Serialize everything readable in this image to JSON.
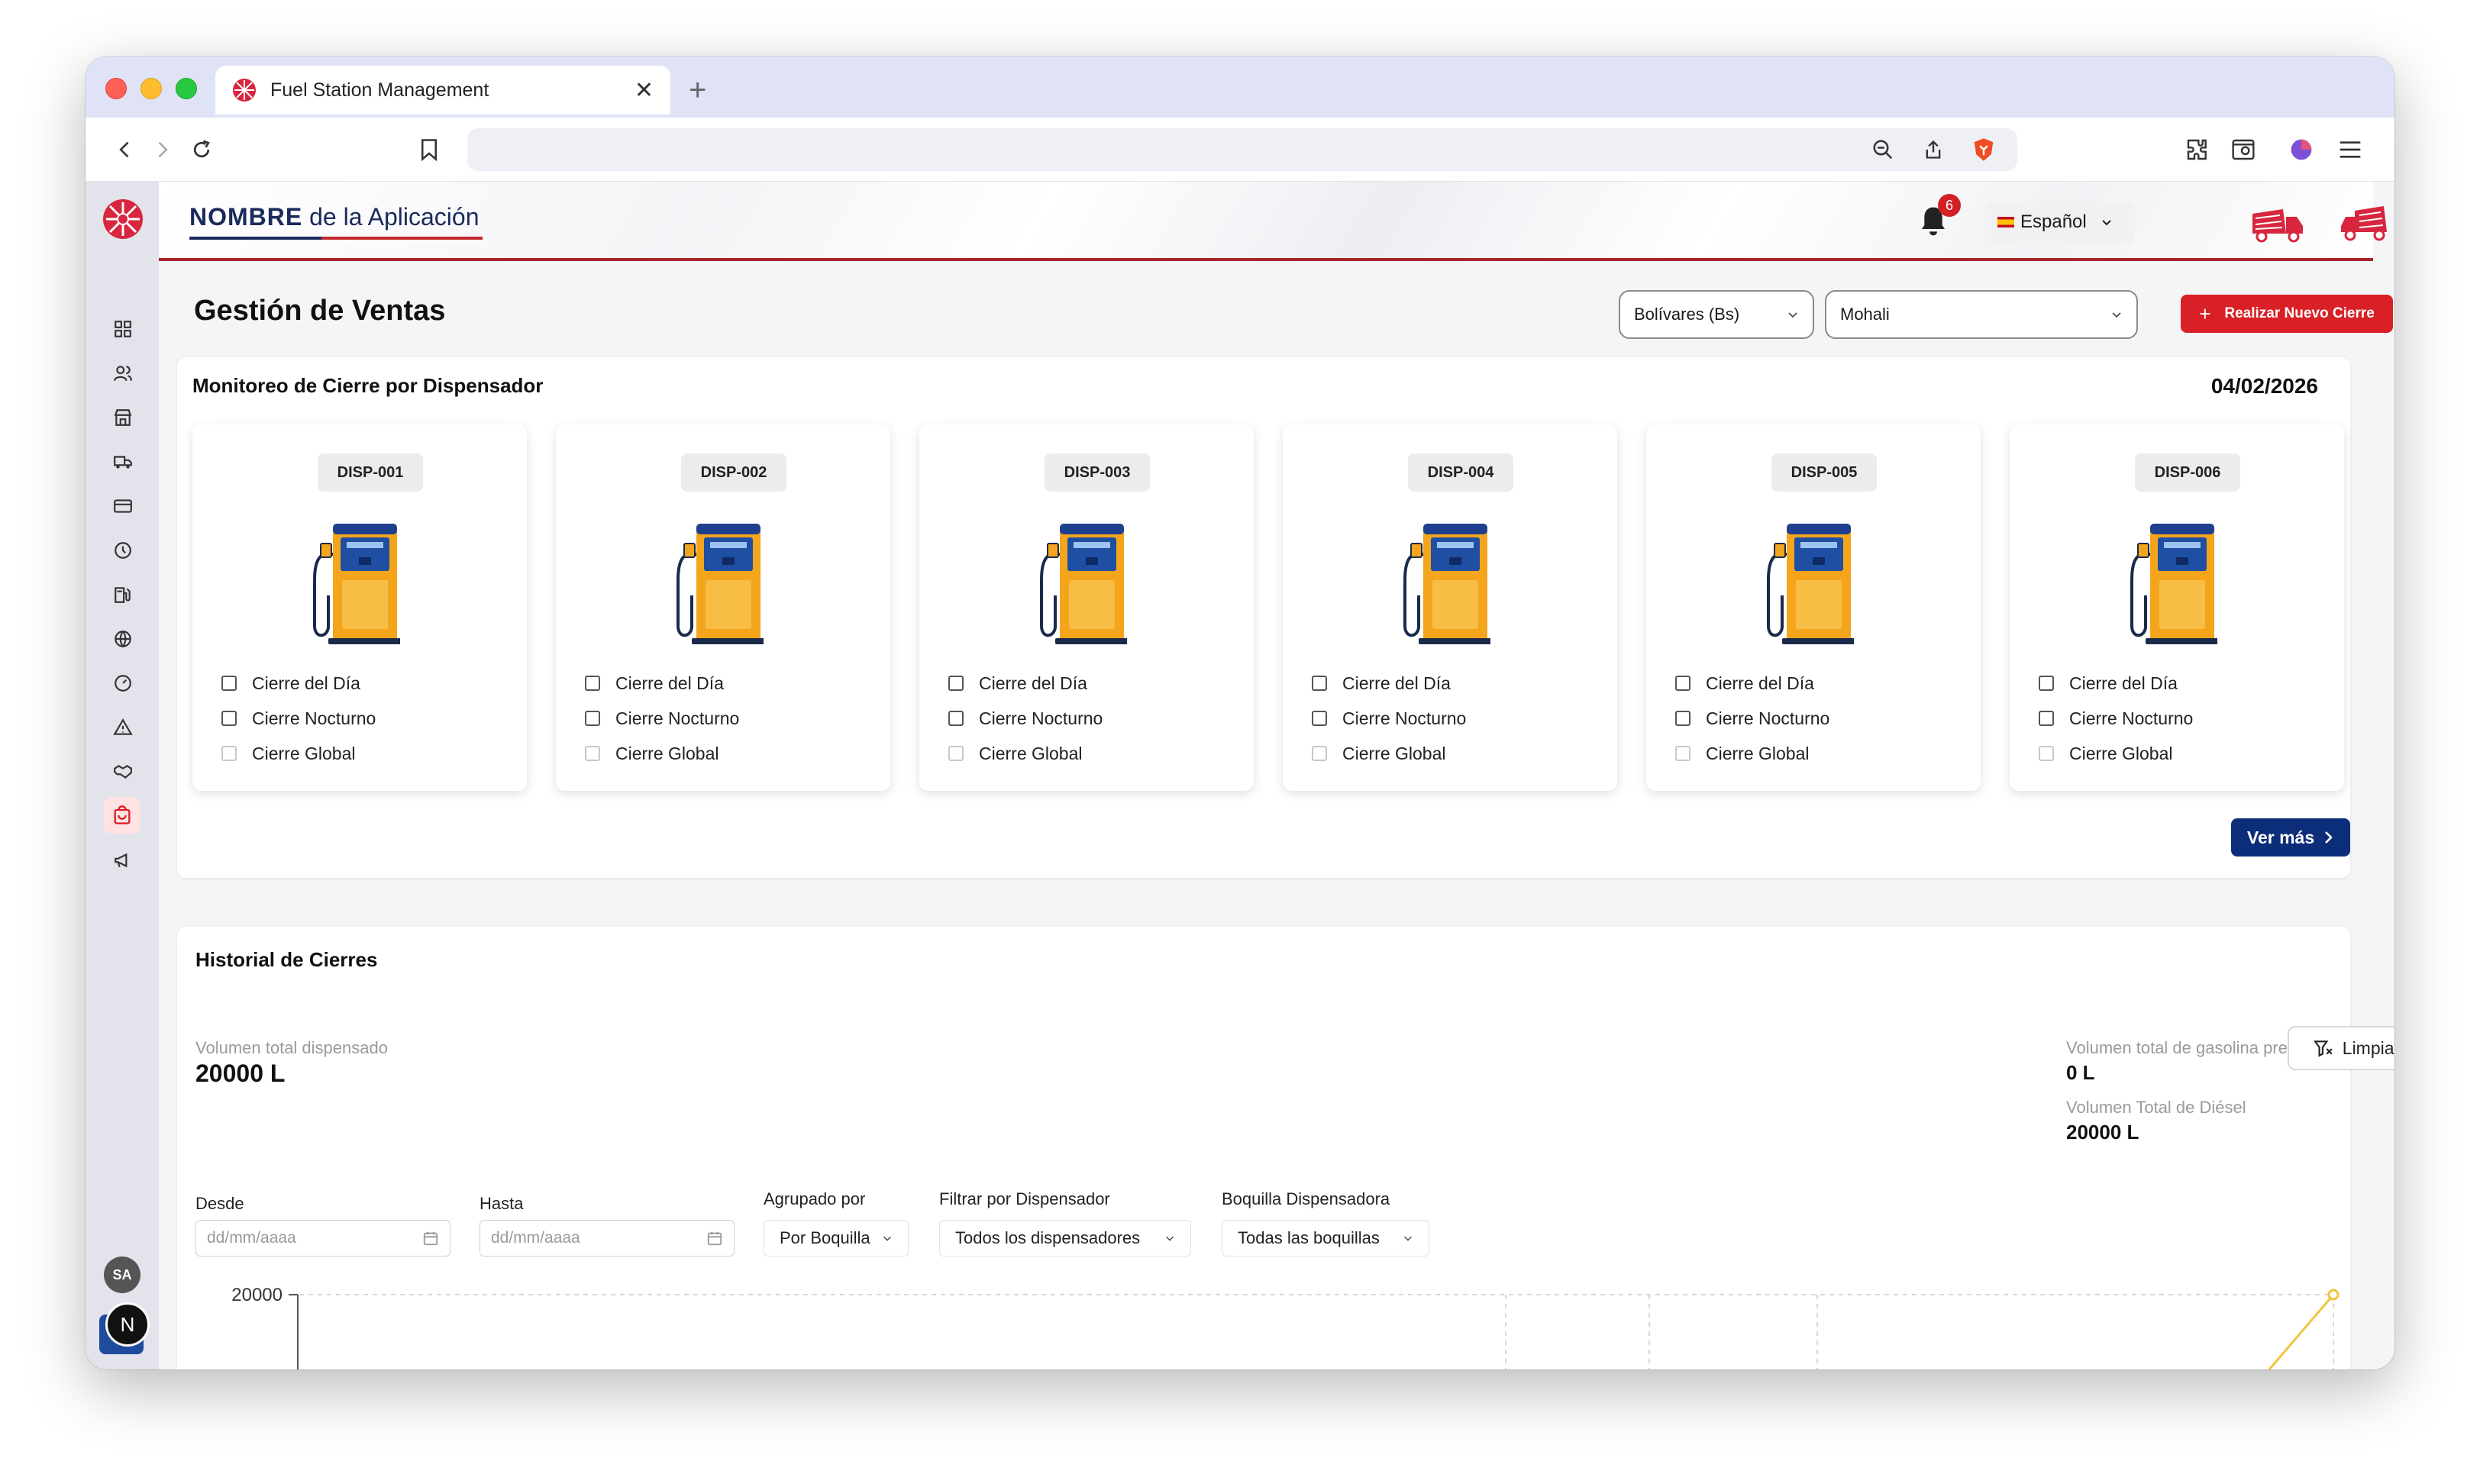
{
  "browser": {
    "tab_title": "Fuel Station Management",
    "tab_close": "✕",
    "new_tab": "+"
  },
  "header": {
    "brand_bold": "NOMBRE",
    "brand_rest": " de la Aplicación",
    "notification_count": "6",
    "language": "Español"
  },
  "page": {
    "title": "Gestión de Ventas",
    "currency_select": "Bolívares (Bs)",
    "station_select": "Mohali",
    "new_closure_button": "Realizar Nuevo Cierre"
  },
  "monitor": {
    "title": "Monitoreo de Cierre por Dispensador",
    "date": "04/02/2026",
    "dispensers": [
      {
        "id": "DISP-001"
      },
      {
        "id": "DISP-002"
      },
      {
        "id": "DISP-003"
      },
      {
        "id": "DISP-004"
      },
      {
        "id": "DISP-005"
      },
      {
        "id": "DISP-006"
      }
    ],
    "checkbox_labels": [
      "Cierre del Día",
      "Cierre Nocturno",
      "Cierre Global"
    ],
    "more_button": "Ver más"
  },
  "history": {
    "title": "Historial de Cierres",
    "total_label": "Volumen total dispensado",
    "total_value": "20000 L",
    "premium_label": "Volumen total de gasolina premium",
    "premium_value": "0 L",
    "diesel_label": "Volumen Total de Diésel",
    "diesel_value": "20000 L",
    "filters": {
      "from_label": "Desde",
      "from_placeholder": "dd/mm/aaaa",
      "to_label": "Hasta",
      "to_placeholder": "dd/mm/aaaa",
      "group_label": "Agrupado por",
      "group_value": "Por Boquilla",
      "dispenser_label": "Filtrar por Dispensador",
      "dispenser_value": "Todos los dispensadores",
      "nozzle_label": "Boquilla Dispensadora",
      "nozzle_value": "Todas las boquillas",
      "clear_button": "Limpiar Filtros"
    },
    "chart_y_tick": "20000"
  },
  "sidebar": {
    "avatar_initials": "SA",
    "n_badge": "N"
  },
  "colors": {
    "accent_red": "#d92027",
    "navy": "#0c2d7a",
    "pump_orange": "#f4a51c",
    "pump_screen": "#1f4fa3"
  }
}
